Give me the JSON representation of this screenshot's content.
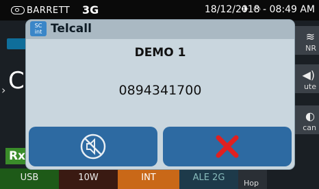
{
  "status_bar": {
    "brand": "BARRETT",
    "network": "3G",
    "datetime": "18/12/2018 - 08:49 AM"
  },
  "dialog": {
    "app_icon_text_top": "SC",
    "app_icon_text_bottom": "int",
    "title": "Telcall",
    "contact_name": "DEMO 1",
    "phone_number": "0894341700",
    "buttons": {
      "mute_icon": "speaker-muted-icon",
      "end_icon": "close-x-icon"
    }
  },
  "background": {
    "left_letter": "C",
    "rx_label": "Rx",
    "right_buttons": [
      {
        "label": "NR",
        "icon": "waveform-icon"
      },
      {
        "label": "ute",
        "icon": "speaker-icon"
      },
      {
        "label": "can",
        "icon": "scan-icon"
      },
      {
        "label": "Hop",
        "icon": ""
      }
    ],
    "bottom_bar": [
      "USB",
      "10W",
      "INT",
      "ALE 2G"
    ]
  },
  "colors": {
    "dialog_bg": "#c9d6de",
    "button_blue": "#2d6aa2",
    "end_red": "#e02020",
    "int_orange": "#c96818"
  }
}
